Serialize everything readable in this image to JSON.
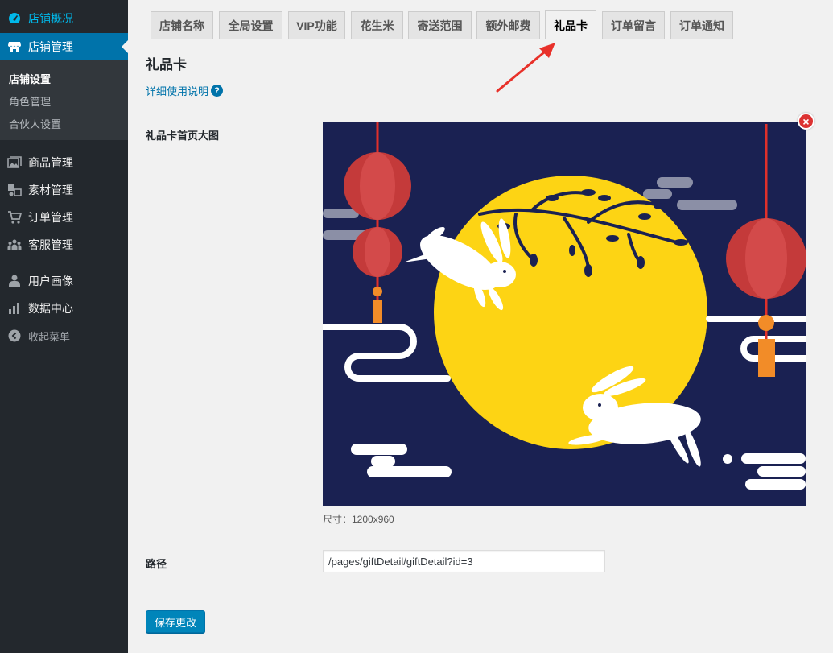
{
  "sidebar": {
    "top_items": [
      {
        "label": "店铺概况",
        "icon": "dashboard-icon"
      },
      {
        "label": "店铺管理",
        "icon": "store-icon"
      }
    ],
    "sub_items": [
      {
        "label": "店铺设置"
      },
      {
        "label": "角色管理"
      },
      {
        "label": "合伙人设置"
      }
    ],
    "items": [
      {
        "label": "商品管理",
        "icon": "gallery-icon"
      },
      {
        "label": "素材管理",
        "icon": "media-icon"
      },
      {
        "label": "订单管理",
        "icon": "cart-icon"
      },
      {
        "label": "客服管理",
        "icon": "groups-icon"
      },
      {
        "label": "用户画像",
        "icon": "user-icon"
      },
      {
        "label": "数据中心",
        "icon": "chart-bar-icon"
      }
    ],
    "collapse_label": "收起菜单"
  },
  "tabs": [
    {
      "label": "店铺名称"
    },
    {
      "label": "全局设置"
    },
    {
      "label": "VIP功能"
    },
    {
      "label": "花生米"
    },
    {
      "label": "寄送范围"
    },
    {
      "label": "额外邮费"
    },
    {
      "label": "礼品卡"
    },
    {
      "label": "订单留言"
    },
    {
      "label": "订单通知"
    }
  ],
  "active_tab": "礼品卡",
  "page": {
    "title": "礼品卡",
    "help_link": "详细使用说明",
    "help_icon": "?",
    "image_label": "礼品卡首页大图",
    "remove_symbol": "×",
    "size_note": "尺寸：1200x960",
    "path_label": "路径",
    "path_value": "/pages/giftDetail/giftDetail?id=3",
    "save_label": "保存更改"
  },
  "colors": {
    "sidebar_bg": "#23282d",
    "active_bg": "#0073aa",
    "link": "#0073aa",
    "button": "#0085ba",
    "night_sky": "#1a2152",
    "moon": "#fdd414",
    "lantern": "#c43a3a",
    "arrow": "#e8312a"
  }
}
